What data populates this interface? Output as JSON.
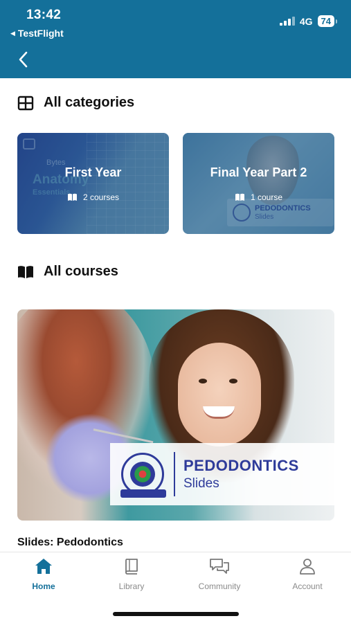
{
  "status_bar": {
    "time": "13:42",
    "back_app": "TestFlight",
    "network": "4G",
    "battery": "74"
  },
  "header": {
    "back_icon": "chevron-left-icon",
    "background_color": "#14709a"
  },
  "categories_section": {
    "title": "All categories",
    "icon": "grid-icon",
    "items": [
      {
        "name": "First Year",
        "count": "2 courses",
        "count_icon": "book-icon"
      },
      {
        "name": "Final Year Part 2",
        "count": "1 course",
        "count_icon": "book-icon"
      }
    ]
  },
  "courses_section": {
    "title": "All courses",
    "icon": "open-book-icon",
    "items": [
      {
        "banner_title": "PEDODONTICS",
        "banner_subtitle": "Slides",
        "caption": "Slides: Pedodontics"
      }
    ]
  },
  "tab_bar": {
    "active": "Home",
    "accent_color": "#14709a",
    "items": [
      {
        "label": "Home",
        "icon": "home-icon"
      },
      {
        "label": "Library",
        "icon": "library-book-icon"
      },
      {
        "label": "Community",
        "icon": "chat-bubbles-icon"
      },
      {
        "label": "Account",
        "icon": "person-icon"
      }
    ]
  }
}
